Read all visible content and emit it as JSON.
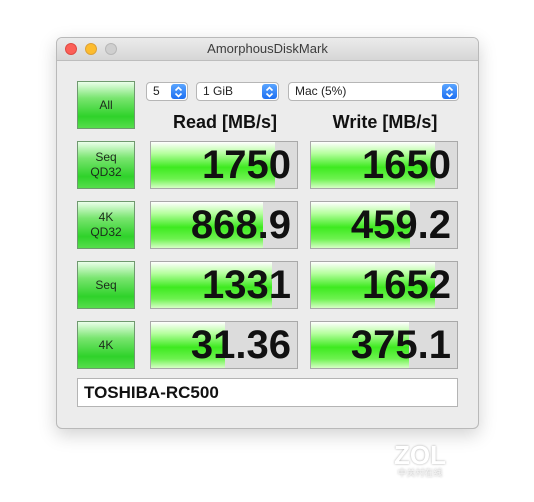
{
  "window": {
    "title": "AmorphousDiskMark"
  },
  "controls": {
    "all_label": "All",
    "count": "5",
    "size": "1 GiB",
    "volume": "Mac (5%)"
  },
  "headers": {
    "read": "Read [MB/s]",
    "write": "Write [MB/s]"
  },
  "tests": [
    {
      "label_line1": "Seq",
      "label_line2": "QD32",
      "read": "1750",
      "write": "1650",
      "read_fill": 0.85,
      "write_fill": 0.85
    },
    {
      "label_line1": "4K",
      "label_line2": "QD32",
      "read": "868.9",
      "write": "459.2",
      "read_fill": 0.77,
      "write_fill": 0.68
    },
    {
      "label_line1": "Seq",
      "label_line2": "",
      "read": "1331",
      "write": "1652",
      "read_fill": 0.83,
      "write_fill": 0.85
    },
    {
      "label_line1": "4K",
      "label_line2": "",
      "read": "31.36",
      "write": "375.1",
      "read_fill": 0.51,
      "write_fill": 0.67
    }
  ],
  "drive": {
    "name": "TOSHIBA-RC500"
  },
  "watermark": {
    "main": "ZOL",
    "sub": "中关村在线"
  },
  "colors": {
    "accent": "#1d6ff2",
    "bar_green": "#3eea20",
    "button_green": "#2fd22a"
  }
}
